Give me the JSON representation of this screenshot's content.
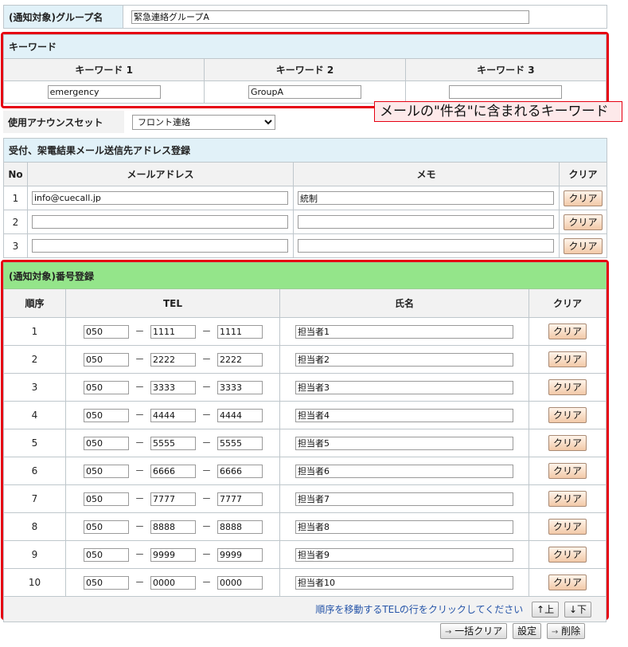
{
  "group": {
    "label": "(通知対象)グループ名",
    "value": "緊急連絡グループA"
  },
  "keywords": {
    "title": "キーワード",
    "headers": [
      "キーワード 1",
      "キーワード 2",
      "キーワード 3"
    ],
    "values": [
      "emergency",
      "GroupA",
      ""
    ],
    "callout": "メールの\"件名\"に含まれるキーワード"
  },
  "announce": {
    "label": "使用アナウンスセット",
    "selected": "フロント連絡"
  },
  "mail": {
    "title": "受付、架電結果メール送信先アドレス登録",
    "headers": {
      "no": "No",
      "address": "メールアドレス",
      "memo": "メモ",
      "clear": "クリア"
    },
    "rows": [
      {
        "no": "1",
        "address": "info@cuecall.jp",
        "memo": "統制",
        "clear": "クリア"
      },
      {
        "no": "2",
        "address": "",
        "memo": "",
        "clear": "クリア"
      },
      {
        "no": "3",
        "address": "",
        "memo": "",
        "clear": "クリア"
      }
    ]
  },
  "numbers": {
    "title": "(通知対象)番号登録",
    "headers": {
      "order": "順序",
      "tel": "TEL",
      "name": "氏名",
      "clear": "クリア"
    },
    "dash": "－",
    "rows": [
      {
        "order": "1",
        "tel1": "050",
        "tel2": "1111",
        "tel3": "1111",
        "name": "担当者1",
        "clear": "クリア"
      },
      {
        "order": "2",
        "tel1": "050",
        "tel2": "2222",
        "tel3": "2222",
        "name": "担当者2",
        "clear": "クリア"
      },
      {
        "order": "3",
        "tel1": "050",
        "tel2": "3333",
        "tel3": "3333",
        "name": "担当者3",
        "clear": "クリア"
      },
      {
        "order": "4",
        "tel1": "050",
        "tel2": "4444",
        "tel3": "4444",
        "name": "担当者4",
        "clear": "クリア"
      },
      {
        "order": "5",
        "tel1": "050",
        "tel2": "5555",
        "tel3": "5555",
        "name": "担当者5",
        "clear": "クリア"
      },
      {
        "order": "6",
        "tel1": "050",
        "tel2": "6666",
        "tel3": "6666",
        "name": "担当者6",
        "clear": "クリア"
      },
      {
        "order": "7",
        "tel1": "050",
        "tel2": "7777",
        "tel3": "7777",
        "name": "担当者7",
        "clear": "クリア"
      },
      {
        "order": "8",
        "tel1": "050",
        "tel2": "8888",
        "tel3": "8888",
        "name": "担当者8",
        "clear": "クリア"
      },
      {
        "order": "9",
        "tel1": "050",
        "tel2": "9999",
        "tel3": "9999",
        "name": "担当者9",
        "clear": "クリア"
      },
      {
        "order": "10",
        "tel1": "050",
        "tel2": "0000",
        "tel3": "0000",
        "name": "担当者10",
        "clear": "クリア"
      }
    ],
    "hint": "順序を移動するTELの行をクリックしてください",
    "up_label": "↑上",
    "down_label": "↓下"
  },
  "actions": {
    "bulk_clear": "一括クリア",
    "save": "設定",
    "delete": "削除"
  },
  "colors": {
    "highlight_border": "#e60012",
    "section_header_blue": "#e1f1f8",
    "section_header_green": "#94e58a",
    "hint_text": "#2554a8"
  }
}
